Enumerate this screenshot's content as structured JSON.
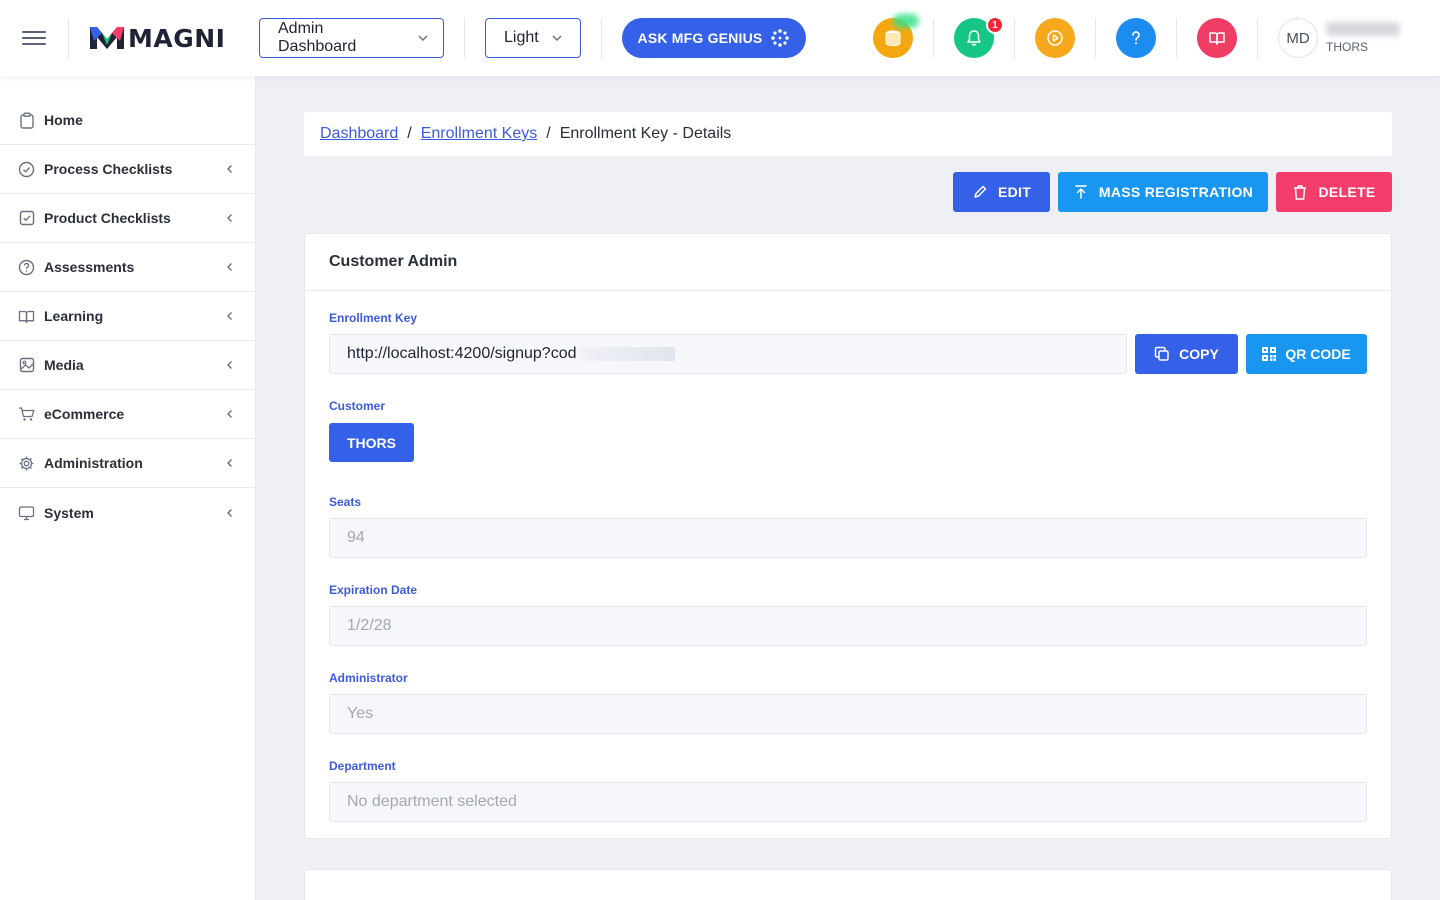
{
  "header": {
    "logo_text": "MAGNI",
    "dashboard_select": "Admin Dashboard",
    "theme_select": "Light",
    "ask_button": "ASK MFG GENIUS",
    "notification_count": "1",
    "avatar_initials": "MD",
    "user_org": "THORS",
    "icons": [
      "menu-icon",
      "coins-icon",
      "bell-icon",
      "play-icon",
      "help-icon",
      "book-icon"
    ],
    "colors": {
      "coins": "#f5a70f",
      "bell": "#16c684",
      "play": "#f7a81b",
      "help": "#1d8cf0",
      "book": "#f03d63"
    }
  },
  "sidebar": {
    "items": [
      {
        "label": "Home",
        "icon": "clipboard-icon"
      },
      {
        "label": "Process Checklists",
        "icon": "check-circle-icon"
      },
      {
        "label": "Product Checklists",
        "icon": "check-square-icon"
      },
      {
        "label": "Assessments",
        "icon": "question-circle-icon"
      },
      {
        "label": "Learning",
        "icon": "book-open-icon"
      },
      {
        "label": "Media",
        "icon": "image-icon"
      },
      {
        "label": "eCommerce",
        "icon": "cart-icon"
      },
      {
        "label": "Administration",
        "icon": "gear-icon"
      },
      {
        "label": "System",
        "icon": "monitor-icon"
      }
    ]
  },
  "breadcrumb": {
    "items": [
      "Dashboard",
      "Enrollment Keys"
    ],
    "current": "Enrollment Key - Details",
    "separator": "/"
  },
  "actions": {
    "edit": "EDIT",
    "mass_registration": "MASS REGISTRATION",
    "delete": "DELETE"
  },
  "card": {
    "title": "Customer Admin",
    "enrollment_key_label": "Enrollment Key",
    "enrollment_key_value": "http://localhost:4200/signup?cod",
    "copy_button": "COPY",
    "qr_button": "QR CODE",
    "customer_label": "Customer",
    "customer_value": "THORS",
    "seats_label": "Seats",
    "seats_value": "94",
    "expiration_label": "Expiration Date",
    "expiration_value": "1/2/28",
    "administrator_label": "Administrator",
    "administrator_value": "Yes",
    "department_label": "Department",
    "department_value": "No department selected"
  },
  "colors": {
    "primary": "#3461e8",
    "info": "#1896f0",
    "danger": "#f53d6b",
    "label": "#3d5bd9",
    "background": "#eef0f6"
  }
}
